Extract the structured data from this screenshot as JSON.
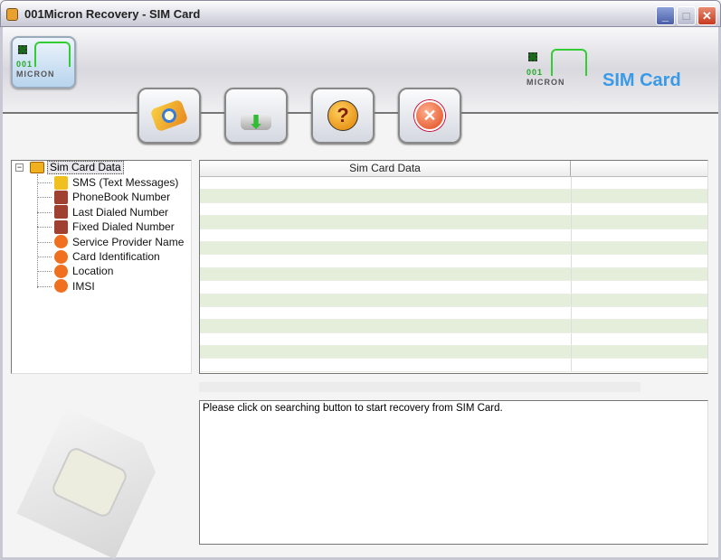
{
  "window": {
    "title": "001Micron Recovery - SIM Card",
    "minimize": "_",
    "maximize": "□",
    "close": "✕"
  },
  "header": {
    "logo_top": "001",
    "logo_bottom": "MICRON",
    "brand_title": "SIM Card"
  },
  "toolbar": [
    {
      "name": "search-sim-button",
      "icon": "sim-search-icon"
    },
    {
      "name": "save-button",
      "icon": "download-drive-icon"
    },
    {
      "name": "help-button",
      "icon": "help-icon",
      "glyph": "?"
    },
    {
      "name": "exit-button",
      "icon": "cancel-icon",
      "glyph": "✕"
    }
  ],
  "tree": {
    "expander": "−",
    "root": "Sim Card Data",
    "items": [
      {
        "label": "SMS (Text Messages)",
        "icon": "envelope-icon"
      },
      {
        "label": "PhoneBook Number",
        "icon": "phone-keypad-icon"
      },
      {
        "label": "Last Dialed Number",
        "icon": "phone-keypad-icon"
      },
      {
        "label": "Fixed Dialed Number",
        "icon": "phone-keypad-icon"
      },
      {
        "label": "Service Provider Name",
        "icon": "info-icon"
      },
      {
        "label": "Card Identification",
        "icon": "info-icon"
      },
      {
        "label": "Location",
        "icon": "info-icon"
      },
      {
        "label": "IMSI",
        "icon": "info-icon"
      }
    ]
  },
  "grid": {
    "columns": [
      "Sim Card Data",
      ""
    ]
  },
  "progress": 0,
  "message": "Please click on searching button to start recovery from SIM Card."
}
